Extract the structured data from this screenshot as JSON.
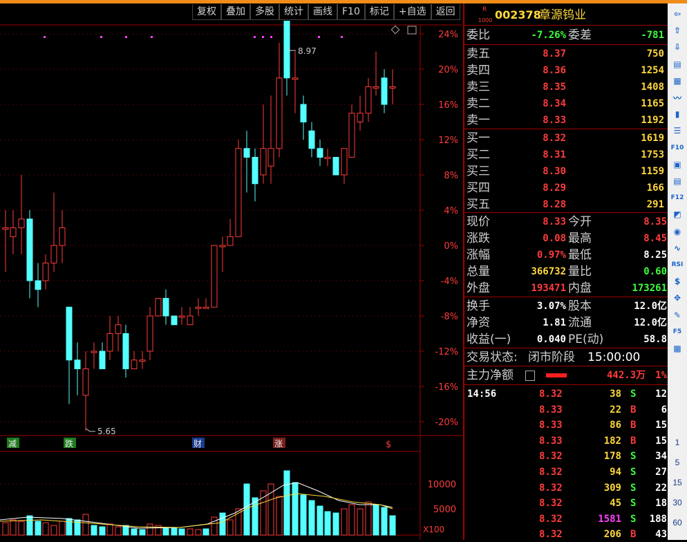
{
  "toolbar": [
    "复权",
    "叠加",
    "多股",
    "统计",
    "画线",
    "F10",
    "标记",
    "+自选",
    "返回"
  ],
  "stock": {
    "code": "002378",
    "name": "章源钨业",
    "badge_top": "R",
    "badge_bottom": "1000"
  },
  "order_book": {
    "weibi_label": "委比",
    "weibi": "-7.26%",
    "weicha_label": "委差",
    "weicha": "-781",
    "asks": [
      {
        "label": "卖五",
        "price": "8.37",
        "vol": "750"
      },
      {
        "label": "卖四",
        "price": "8.36",
        "vol": "1254"
      },
      {
        "label": "卖三",
        "price": "8.35",
        "vol": "1408"
      },
      {
        "label": "卖二",
        "price": "8.34",
        "vol": "1165"
      },
      {
        "label": "卖一",
        "price": "8.33",
        "vol": "1192"
      }
    ],
    "bids": [
      {
        "label": "买一",
        "price": "8.32",
        "vol": "1619"
      },
      {
        "label": "买二",
        "price": "8.31",
        "vol": "1753"
      },
      {
        "label": "买三",
        "price": "8.30",
        "vol": "1159"
      },
      {
        "label": "买四",
        "price": "8.29",
        "vol": "166"
      },
      {
        "label": "买五",
        "price": "8.28",
        "vol": "291"
      }
    ]
  },
  "quote": [
    {
      "l1": "现价",
      "v1": "8.33",
      "l2": "今开",
      "v2": "8.35",
      "c1": "red",
      "c2": "red"
    },
    {
      "l1": "涨跌",
      "v1": "0.08",
      "l2": "最高",
      "v2": "8.45",
      "c1": "red",
      "c2": "red"
    },
    {
      "l1": "涨幅",
      "v1": "0.97%",
      "l2": "最低",
      "v2": "8.25",
      "c1": "red",
      "c2": "white"
    },
    {
      "l1": "总量",
      "v1": "366732",
      "l2": "量比",
      "v2": "0.60",
      "c1": "yellow",
      "c2": "green"
    },
    {
      "l1": "外盘",
      "v1": "193471",
      "l2": "内盘",
      "v2": "173261",
      "c1": "red",
      "c2": "green"
    }
  ],
  "fundamentals": [
    {
      "l1": "换手",
      "v1": "3.07%",
      "l2": "股本",
      "v2": "12.0亿"
    },
    {
      "l1": "净资",
      "v1": "1.81",
      "l2": "流通",
      "v2": "12.0亿"
    },
    {
      "l1": "收益(一)",
      "v1": "0.040",
      "l2": "PE(动)",
      "v2": "58.8"
    }
  ],
  "status": {
    "label": "交易状态:",
    "value": "闭市阶段",
    "time": "15:00:00"
  },
  "main_force": {
    "label": "主力净额",
    "value": "442.3万",
    "pct": "1%"
  },
  "ticks": [
    {
      "time": "14:56",
      "price": "8.32",
      "vol": "38",
      "side": "S",
      "n": "12"
    },
    {
      "time": "",
      "price": "8.33",
      "vol": "22",
      "side": "B",
      "n": "6"
    },
    {
      "time": "",
      "price": "8.33",
      "vol": "86",
      "side": "B",
      "n": "15"
    },
    {
      "time": "",
      "price": "8.33",
      "vol": "182",
      "side": "B",
      "n": "15"
    },
    {
      "time": "",
      "price": "8.32",
      "vol": "178",
      "side": "S",
      "n": "34"
    },
    {
      "time": "",
      "price": "8.32",
      "vol": "94",
      "side": "S",
      "n": "27"
    },
    {
      "time": "",
      "price": "8.32",
      "vol": "309",
      "side": "S",
      "n": "22"
    },
    {
      "time": "",
      "price": "8.32",
      "vol": "45",
      "side": "S",
      "n": "18"
    },
    {
      "time": "",
      "price": "8.32",
      "vol": "1581",
      "side": "S",
      "n": "188"
    },
    {
      "time": "",
      "price": "8.32",
      "vol": "206",
      "side": "B",
      "n": "43"
    }
  ],
  "chart": {
    "high_label": "8.97",
    "low_label": "5.65",
    "pct_ticks": [
      "24%",
      "20%",
      "16%",
      "12%",
      "8%",
      "4%",
      "0%",
      "-4%",
      "-8%",
      "-12%",
      "-16%",
      "-20%"
    ],
    "vol_ticks": [
      "10000",
      "5000"
    ],
    "vol_unit": "X100",
    "events": [
      {
        "text": "减",
        "kind": "green"
      },
      {
        "text": "跌",
        "kind": "green"
      },
      {
        "text": "财",
        "kind": "blue"
      },
      {
        "text": "涨",
        "kind": "red"
      },
      {
        "text": "$",
        "kind": "redtext"
      }
    ]
  },
  "sidebar_numbers": [
    "1",
    "5",
    "15",
    "30",
    "60"
  ],
  "sidebar_labels": {
    "rsi": "RSI",
    "f10": "F10",
    "f12": "F12",
    "f5": "F5"
  },
  "colors": {
    "up": "#ff3c3c",
    "down": "#54ffff",
    "accent": "#f08c1a"
  }
}
